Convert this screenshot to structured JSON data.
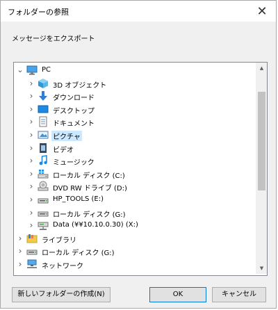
{
  "window": {
    "title": "フォルダーの参照",
    "close_symbol": "✕"
  },
  "description": "メッセージをエクスポート",
  "tree": [
    {
      "label": "PC",
      "icon": "pc-icon",
      "expanded": true,
      "level": 0
    },
    {
      "label": "3D オブジェクト",
      "icon": "3d-objects-icon",
      "level": 1
    },
    {
      "label": "ダウンロード",
      "icon": "download-icon",
      "level": 1
    },
    {
      "label": "デスクトップ",
      "icon": "desktop-icon",
      "level": 1
    },
    {
      "label": "ドキュメント",
      "icon": "documents-icon",
      "level": 1
    },
    {
      "label": "ピクチャ",
      "icon": "pictures-icon",
      "level": 1,
      "selected": true
    },
    {
      "label": "ビデオ",
      "icon": "videos-icon",
      "level": 1
    },
    {
      "label": "ミュージック",
      "icon": "music-icon",
      "level": 1
    },
    {
      "label": "ローカル ディスク (C:)",
      "icon": "windows-drive-icon",
      "level": 1
    },
    {
      "label": "DVD RW ドライブ (D:)",
      "icon": "dvd-drive-icon",
      "level": 1
    },
    {
      "label": "HP_TOOLS (E:)",
      "icon": "drive-icon",
      "level": 1
    },
    {
      "label": "ローカル ディスク (G:)",
      "icon": "drive-icon",
      "level": 1
    },
    {
      "label": "Data (¥¥10.10.0.30) (X:)",
      "icon": "network-drive-icon",
      "level": 1
    },
    {
      "label": "ライブラリ",
      "icon": "library-icon",
      "level": 0
    },
    {
      "label": "ローカル ディスク (G:)",
      "icon": "drive-icon",
      "level": 0
    },
    {
      "label": "ネットワーク",
      "icon": "network-icon",
      "level": 0
    }
  ],
  "buttons": {
    "new_folder": "新しいフォルダーの作成(N)",
    "ok": "OK",
    "cancel": "キャンセル"
  },
  "colors": {
    "selection": "#cce8ff",
    "default_button_border": "#0078d7",
    "folder_blue": "#1e90ff"
  }
}
